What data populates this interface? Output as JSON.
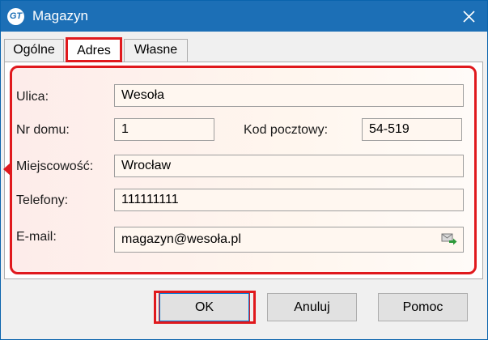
{
  "window": {
    "title": "Magazyn",
    "app_icon_text": "GT",
    "accent_color": "#1c6fb6",
    "highlight_color": "#e0191d"
  },
  "tabs": [
    {
      "label": "Ogólne",
      "active": false
    },
    {
      "label": "Adres",
      "active": true
    },
    {
      "label": "Własne",
      "active": false
    }
  ],
  "form": {
    "street": {
      "label": "Ulica:",
      "value": "Wesoła"
    },
    "house_no": {
      "label": "Nr domu:",
      "value": "1"
    },
    "postal_code": {
      "label": "Kod pocztowy:",
      "value": "54-519"
    },
    "city": {
      "label": "Miejscowość:",
      "value": "Wrocław"
    },
    "phones": {
      "label": "Telefony:",
      "value": "111111111"
    },
    "email": {
      "label": "E-mail:",
      "value": "magazyn@wesoła.pl",
      "icon": "send-mail-icon"
    }
  },
  "buttons": {
    "ok": "OK",
    "cancel": "Anuluj",
    "help": "Pomoc"
  }
}
